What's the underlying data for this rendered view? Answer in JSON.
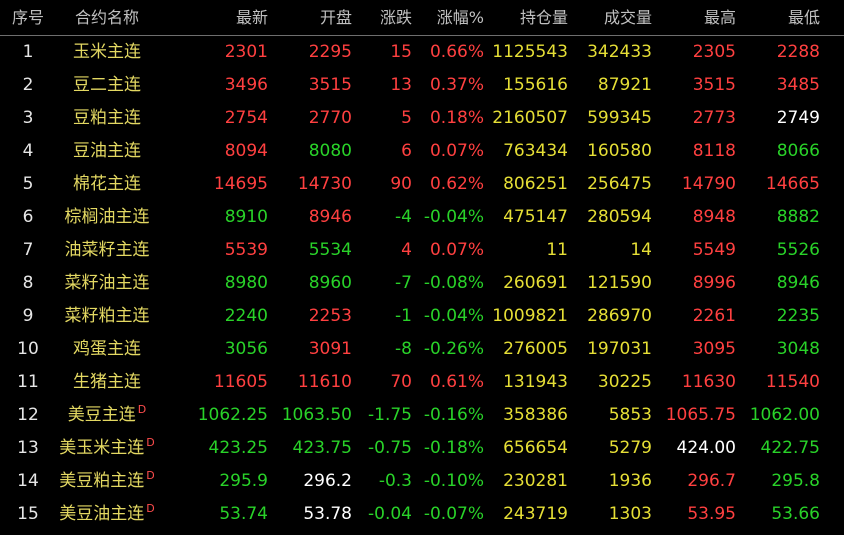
{
  "colors": {
    "up": "#ff4040",
    "down": "#29d229",
    "flat": "#ffffff",
    "volume": "#e6df36",
    "name": "#e3d862",
    "header": "#c0c0c0"
  },
  "headers": [
    "序号",
    "合约名称",
    "最新",
    "开盘",
    "涨跌",
    "涨幅%",
    "持仓量",
    "成交量",
    "最高",
    "最低"
  ],
  "rows": [
    {
      "idx": "1",
      "name": "玉米主连",
      "sup": "",
      "latest": "2301",
      "open": "2295",
      "chg": "15",
      "pct": "0.66%",
      "oi": "1125543",
      "vol": "342433",
      "high": "2305",
      "low": "2288",
      "colors": {
        "latest": "up",
        "open": "up",
        "chg": "up",
        "pct": "up",
        "high": "up",
        "low": "up"
      }
    },
    {
      "idx": "2",
      "name": "豆二主连",
      "sup": "",
      "latest": "3496",
      "open": "3515",
      "chg": "13",
      "pct": "0.37%",
      "oi": "155616",
      "vol": "87921",
      "high": "3515",
      "low": "3485",
      "colors": {
        "latest": "up",
        "open": "up",
        "chg": "up",
        "pct": "up",
        "high": "up",
        "low": "up"
      }
    },
    {
      "idx": "3",
      "name": "豆粕主连",
      "sup": "",
      "latest": "2754",
      "open": "2770",
      "chg": "5",
      "pct": "0.18%",
      "oi": "2160507",
      "vol": "599345",
      "high": "2773",
      "low": "2749",
      "colors": {
        "latest": "up",
        "open": "up",
        "chg": "up",
        "pct": "up",
        "high": "up",
        "low": "flat"
      }
    },
    {
      "idx": "4",
      "name": "豆油主连",
      "sup": "",
      "latest": "8094",
      "open": "8080",
      "chg": "6",
      "pct": "0.07%",
      "oi": "763434",
      "vol": "160580",
      "high": "8118",
      "low": "8066",
      "colors": {
        "latest": "up",
        "open": "down",
        "chg": "up",
        "pct": "up",
        "high": "up",
        "low": "down"
      }
    },
    {
      "idx": "5",
      "name": "棉花主连",
      "sup": "",
      "latest": "14695",
      "open": "14730",
      "chg": "90",
      "pct": "0.62%",
      "oi": "806251",
      "vol": "256475",
      "high": "14790",
      "low": "14665",
      "colors": {
        "latest": "up",
        "open": "up",
        "chg": "up",
        "pct": "up",
        "high": "up",
        "low": "up"
      }
    },
    {
      "idx": "6",
      "name": "棕榈油主连",
      "sup": "",
      "latest": "8910",
      "open": "8946",
      "chg": "-4",
      "pct": "-0.04%",
      "oi": "475147",
      "vol": "280594",
      "high": "8948",
      "low": "8882",
      "colors": {
        "latest": "down",
        "open": "up",
        "chg": "down",
        "pct": "down",
        "high": "up",
        "low": "down"
      }
    },
    {
      "idx": "7",
      "name": "油菜籽主连",
      "sup": "",
      "latest": "5539",
      "open": "5534",
      "chg": "4",
      "pct": "0.07%",
      "oi": "11",
      "vol": "14",
      "high": "5549",
      "low": "5526",
      "colors": {
        "latest": "up",
        "open": "down",
        "chg": "up",
        "pct": "up",
        "high": "up",
        "low": "down"
      }
    },
    {
      "idx": "8",
      "name": "菜籽油主连",
      "sup": "",
      "latest": "8980",
      "open": "8960",
      "chg": "-7",
      "pct": "-0.08%",
      "oi": "260691",
      "vol": "121590",
      "high": "8996",
      "low": "8946",
      "colors": {
        "latest": "down",
        "open": "down",
        "chg": "down",
        "pct": "down",
        "high": "up",
        "low": "down"
      }
    },
    {
      "idx": "9",
      "name": "菜籽粕主连",
      "sup": "",
      "latest": "2240",
      "open": "2253",
      "chg": "-1",
      "pct": "-0.04%",
      "oi": "1009821",
      "vol": "286970",
      "high": "2261",
      "low": "2235",
      "colors": {
        "latest": "down",
        "open": "up",
        "chg": "down",
        "pct": "down",
        "high": "up",
        "low": "down"
      }
    },
    {
      "idx": "10",
      "name": "鸡蛋主连",
      "sup": "",
      "latest": "3056",
      "open": "3091",
      "chg": "-8",
      "pct": "-0.26%",
      "oi": "276005",
      "vol": "197031",
      "high": "3095",
      "low": "3048",
      "colors": {
        "latest": "down",
        "open": "up",
        "chg": "down",
        "pct": "down",
        "high": "up",
        "low": "down"
      }
    },
    {
      "idx": "11",
      "name": "生猪主连",
      "sup": "",
      "latest": "11605",
      "open": "11610",
      "chg": "70",
      "pct": "0.61%",
      "oi": "131943",
      "vol": "30225",
      "high": "11630",
      "low": "11540",
      "colors": {
        "latest": "up",
        "open": "up",
        "chg": "up",
        "pct": "up",
        "high": "up",
        "low": "up"
      }
    },
    {
      "idx": "12",
      "name": "美豆主连",
      "sup": "D",
      "latest": "1062.25",
      "open": "1063.50",
      "chg": "-1.75",
      "pct": "-0.16%",
      "oi": "358386",
      "vol": "5853",
      "high": "1065.75",
      "low": "1062.00",
      "colors": {
        "latest": "down",
        "open": "down",
        "chg": "down",
        "pct": "down",
        "high": "up",
        "low": "down"
      }
    },
    {
      "idx": "13",
      "name": "美玉米主连",
      "sup": "D",
      "latest": "423.25",
      "open": "423.75",
      "chg": "-0.75",
      "pct": "-0.18%",
      "oi": "656654",
      "vol": "5279",
      "high": "424.00",
      "low": "422.75",
      "colors": {
        "latest": "down",
        "open": "down",
        "chg": "down",
        "pct": "down",
        "high": "flat",
        "low": "down"
      }
    },
    {
      "idx": "14",
      "name": "美豆粕主连",
      "sup": "D",
      "latest": "295.9",
      "open": "296.2",
      "chg": "-0.3",
      "pct": "-0.10%",
      "oi": "230281",
      "vol": "1936",
      "high": "296.7",
      "low": "295.8",
      "colors": {
        "latest": "down",
        "open": "flat",
        "chg": "down",
        "pct": "down",
        "high": "up",
        "low": "down"
      }
    },
    {
      "idx": "15",
      "name": "美豆油主连",
      "sup": "D",
      "latest": "53.74",
      "open": "53.78",
      "chg": "-0.04",
      "pct": "-0.07%",
      "oi": "243719",
      "vol": "1303",
      "high": "53.95",
      "low": "53.66",
      "colors": {
        "latest": "down",
        "open": "flat",
        "chg": "down",
        "pct": "down",
        "high": "up",
        "low": "down"
      }
    }
  ]
}
